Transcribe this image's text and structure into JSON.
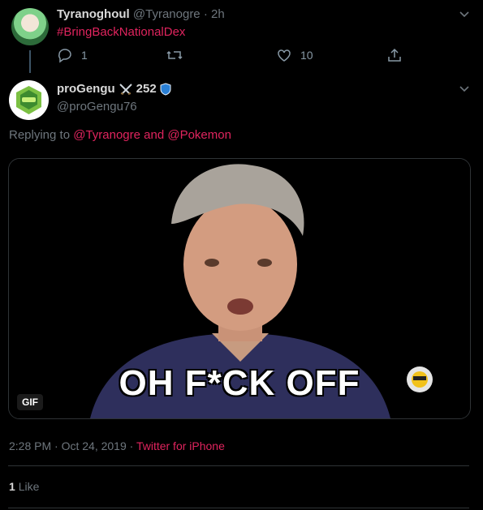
{
  "parent_tweet": {
    "display_name": "Tyranoghoul",
    "handle": "@Tyranogre",
    "separator": "·",
    "time": "2h",
    "text": "#BringBackNationalDex",
    "reply_count": "1",
    "like_count": "10"
  },
  "main_tweet": {
    "display_name": "proGengu",
    "name_badge_text": "252",
    "handle": "@proGengu76",
    "replying_prefix": "Replying to ",
    "reply_to_1": "@Tyranogre",
    "replying_and": " and ",
    "reply_to_2": "@Pokemon",
    "gif_badge": "GIF",
    "gif_caption": "OH F*CK OFF",
    "timestamp": "2:28 PM · Oct 24, 2019 · ",
    "source": "Twitter for iPhone",
    "likes_count": "1",
    "likes_label": "Like"
  },
  "colors": {
    "background": "#000000",
    "accent": "#e0245e",
    "muted": "#6e767d",
    "border": "#2f3336"
  },
  "icons": {
    "reply": "reply-icon",
    "retweet": "retweet-icon",
    "like": "heart-icon",
    "share": "share-icon",
    "more": "chevron-down-icon",
    "badge_swords": "crossed-swords-icon",
    "badge_shield": "shield-icon"
  }
}
